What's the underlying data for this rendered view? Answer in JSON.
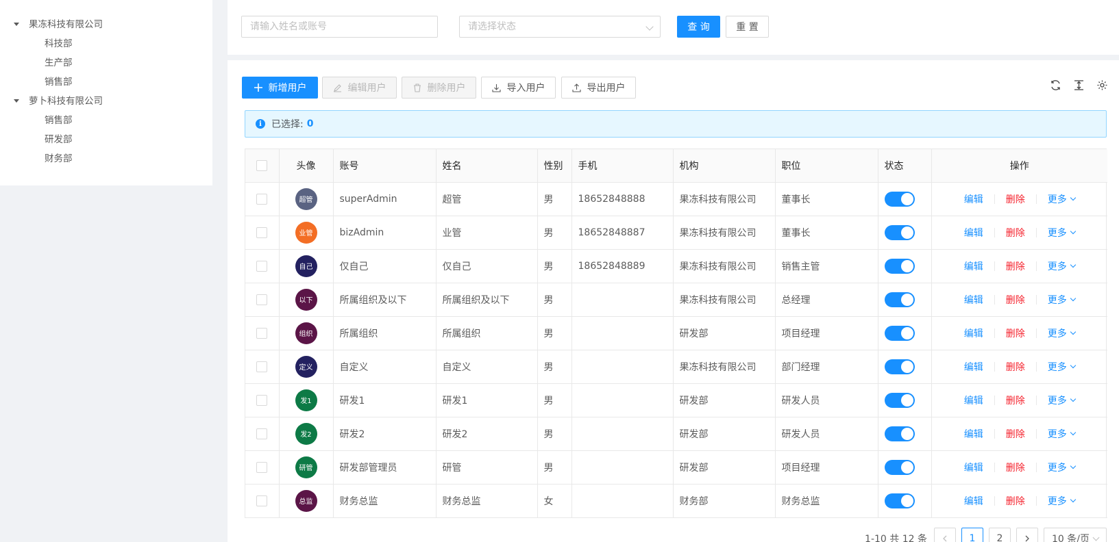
{
  "tree": [
    {
      "label": "果冻科技有限公司",
      "children": [
        "科技部",
        "生产部",
        "销售部"
      ]
    },
    {
      "label": "萝卜科技有限公司",
      "children": [
        "销售部",
        "研发部",
        "财务部"
      ]
    }
  ],
  "search": {
    "name_placeholder": "请输入姓名或账号",
    "status_placeholder": "请选择状态",
    "query_label": "查 询",
    "reset_label": "重 置"
  },
  "toolbar": {
    "add_label": "新增用户",
    "edit_label": "编辑用户",
    "delete_label": "删除用户",
    "import_label": "导入用户",
    "export_label": "导出用户"
  },
  "alert": {
    "label": "已选择:",
    "count": "0"
  },
  "table": {
    "headers": {
      "avatar": "头像",
      "account": "账号",
      "name": "姓名",
      "gender": "性别",
      "phone": "手机",
      "org": "机构",
      "position": "职位",
      "status": "状态",
      "ops": "操作"
    },
    "ops": {
      "edit": "编辑",
      "delete": "删除",
      "more": "更多"
    },
    "rows": [
      {
        "avatar": "超管",
        "avatar_color": "#5a6382",
        "account": "superAdmin",
        "name": "超管",
        "gender": "男",
        "phone": "18652848888",
        "org": "果冻科技有限公司",
        "position": "董事长"
      },
      {
        "avatar": "业管",
        "avatar_color": "#f36e25",
        "account": "bizAdmin",
        "name": "业管",
        "gender": "男",
        "phone": "18652848887",
        "org": "果冻科技有限公司",
        "position": "董事长"
      },
      {
        "avatar": "自己",
        "avatar_color": "#232160",
        "account": "仅自己",
        "name": "仅自己",
        "gender": "男",
        "phone": "18652848889",
        "org": "果冻科技有限公司",
        "position": "销售主管"
      },
      {
        "avatar": "以下",
        "avatar_color": "#5b1547",
        "account": "所属组织及以下",
        "name": "所属组织及以下",
        "gender": "男",
        "phone": "",
        "org": "果冻科技有限公司",
        "position": "总经理"
      },
      {
        "avatar": "组织",
        "avatar_color": "#5b1547",
        "account": "所属组织",
        "name": "所属组织",
        "gender": "男",
        "phone": "",
        "org": "研发部",
        "position": "项目经理"
      },
      {
        "avatar": "定义",
        "avatar_color": "#232160",
        "account": "自定义",
        "name": "自定义",
        "gender": "男",
        "phone": "",
        "org": "果冻科技有限公司",
        "position": "部门经理"
      },
      {
        "avatar": "发1",
        "avatar_color": "#0d7a46",
        "account": "研发1",
        "name": "研发1",
        "gender": "男",
        "phone": "",
        "org": "研发部",
        "position": "研发人员"
      },
      {
        "avatar": "发2",
        "avatar_color": "#0d7a46",
        "account": "研发2",
        "name": "研发2",
        "gender": "男",
        "phone": "",
        "org": "研发部",
        "position": "研发人员"
      },
      {
        "avatar": "研管",
        "avatar_color": "#0d7a46",
        "account": "研发部管理员",
        "name": "研管",
        "gender": "男",
        "phone": "",
        "org": "研发部",
        "position": "项目经理"
      },
      {
        "avatar": "总监",
        "avatar_color": "#5b1547",
        "account": "财务总监",
        "name": "财务总监",
        "gender": "女",
        "phone": "",
        "org": "财务部",
        "position": "财务总监"
      }
    ]
  },
  "pagination": {
    "total": "1-10 共 12 条",
    "pages": [
      "1",
      "2"
    ],
    "current": "1",
    "page_size": "10 条/页"
  },
  "colors": {
    "primary": "#1890ff",
    "danger": "#f5222d",
    "background": "#f0f2f5"
  },
  "icons": [
    "plus-icon",
    "edit-icon",
    "delete-icon",
    "import-icon",
    "export-icon",
    "refresh-icon",
    "column-height-icon",
    "settings-icon",
    "info-icon",
    "chevron-down-icon"
  ]
}
